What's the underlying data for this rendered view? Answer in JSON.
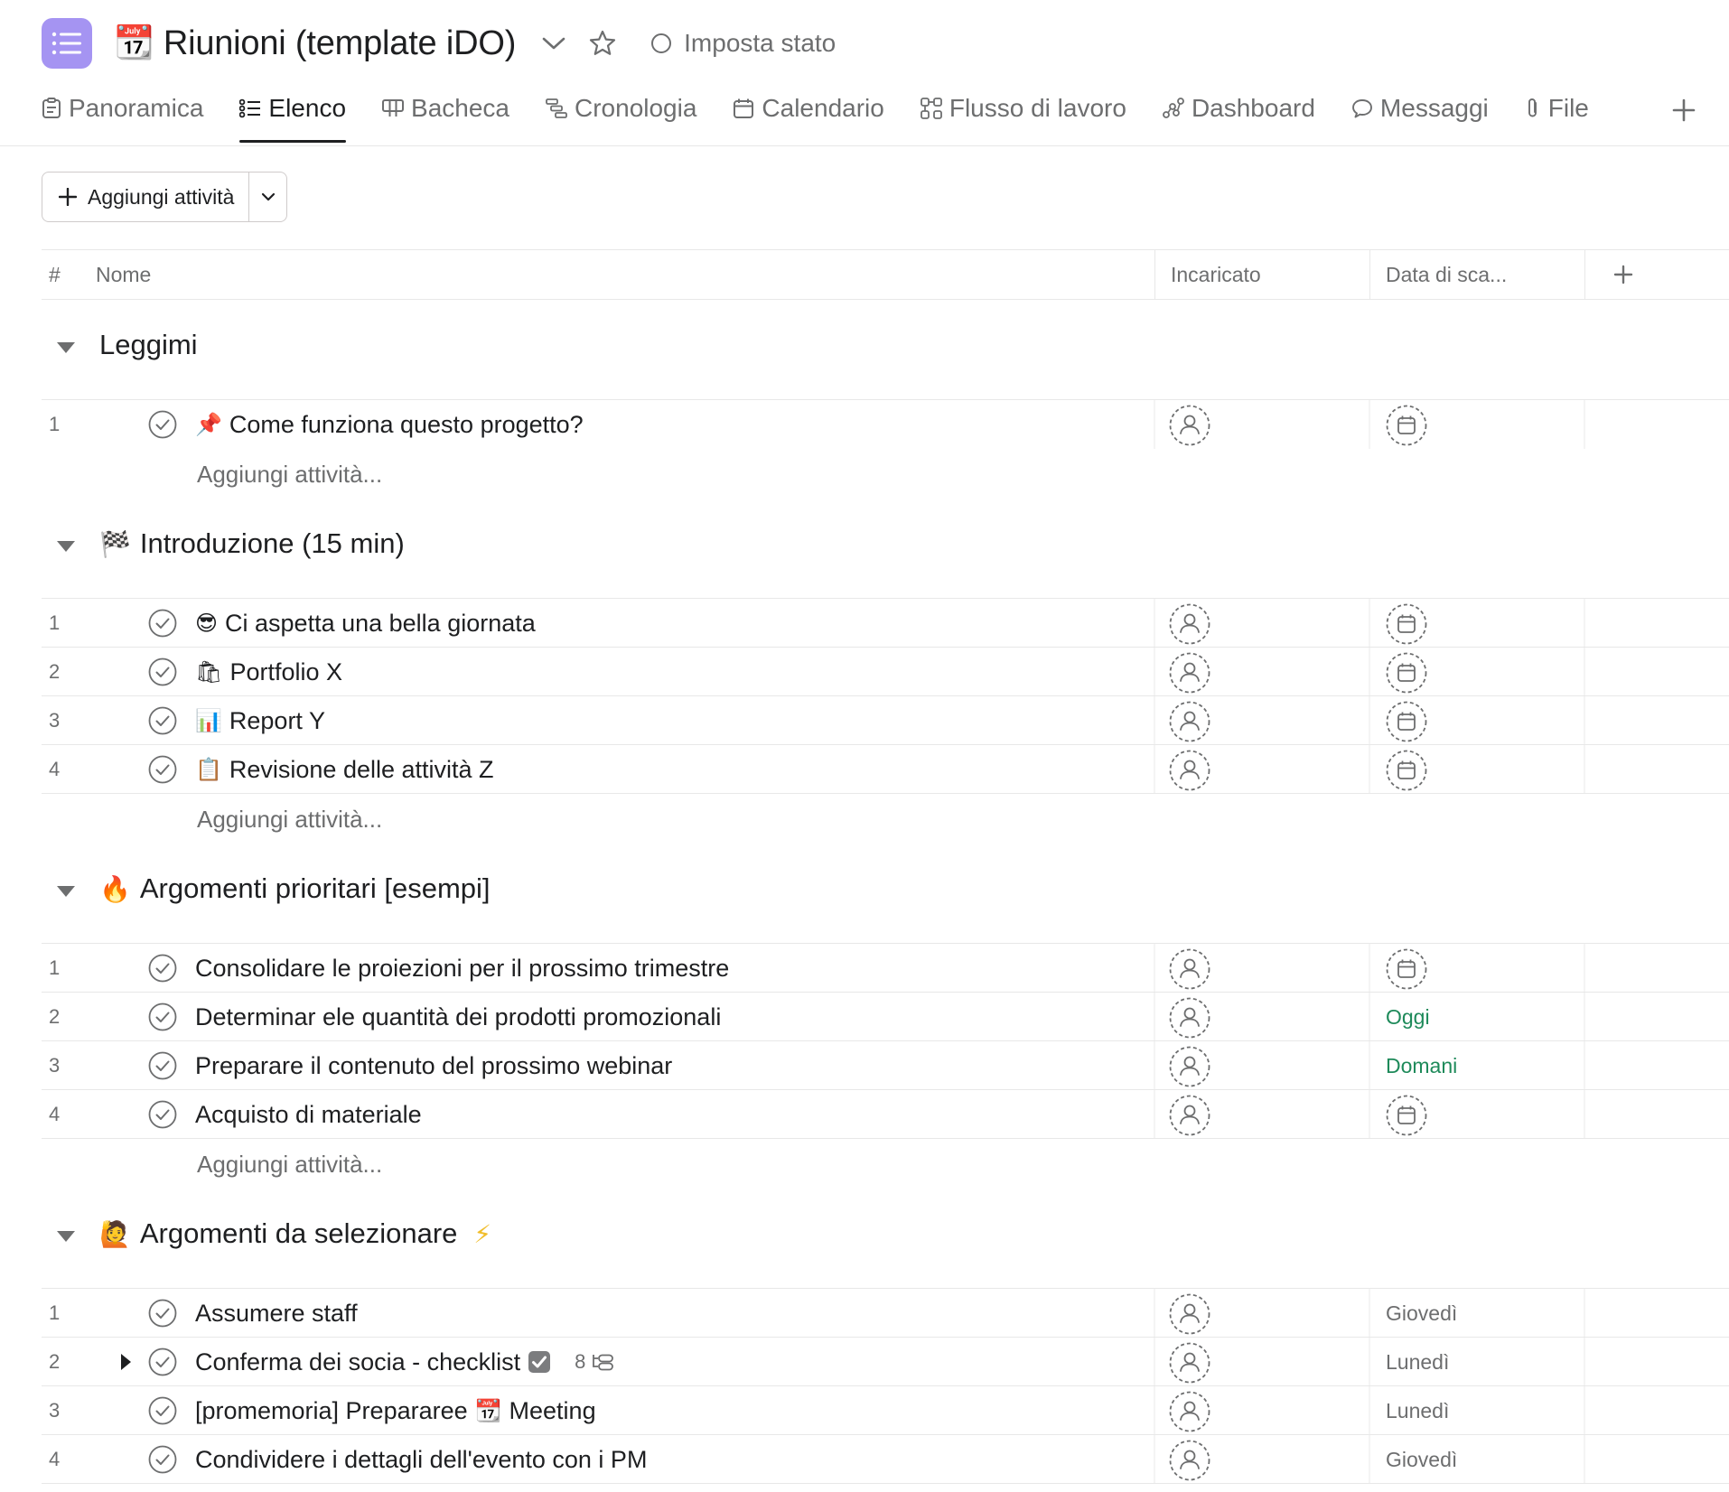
{
  "header": {
    "project_emoji": "📆",
    "project_title": "Riunioni (template iDO)",
    "status_label": "Imposta stato"
  },
  "tabs": [
    {
      "label": "Panoramica",
      "icon": "clipboard-icon",
      "active": false
    },
    {
      "label": "Elenco",
      "icon": "list-icon",
      "active": true
    },
    {
      "label": "Bacheca",
      "icon": "board-icon",
      "active": false
    },
    {
      "label": "Cronologia",
      "icon": "timeline-icon",
      "active": false
    },
    {
      "label": "Calendario",
      "icon": "calendar-icon",
      "active": false
    },
    {
      "label": "Flusso di lavoro",
      "icon": "workflow-icon",
      "active": false
    },
    {
      "label": "Dashboard",
      "icon": "dashboard-icon",
      "active": false
    },
    {
      "label": "Messaggi",
      "icon": "message-icon",
      "active": false
    },
    {
      "label": "File",
      "icon": "paperclip-icon",
      "active": false
    }
  ],
  "toolbar": {
    "add_task_label": "Aggiungi attività"
  },
  "table": {
    "col_num": "#",
    "col_name": "Nome",
    "col_assignee": "Incaricato",
    "col_due": "Data di sca..."
  },
  "add_task_placeholder": "Aggiungi attività...",
  "sections": [
    {
      "title": "Leggimi",
      "emoji": "",
      "tasks": [
        {
          "num": "1",
          "emoji": "📌",
          "name": "Come funziona questo progetto?",
          "due": ""
        }
      ]
    },
    {
      "title": "Introduzione (15 min)",
      "emoji": "🏁",
      "tasks": [
        {
          "num": "1",
          "emoji": "😎",
          "name": "Ci aspetta una bella giornata",
          "due": ""
        },
        {
          "num": "2",
          "emoji": "🛍",
          "name": "Portfolio X",
          "due": ""
        },
        {
          "num": "3",
          "emoji": "📊",
          "name": "Report Y",
          "due": ""
        },
        {
          "num": "4",
          "emoji": "📋",
          "name": "Revisione delle attività Z",
          "due": ""
        }
      ]
    },
    {
      "title": "Argomenti prioritari [esempi]",
      "emoji": "🔥",
      "tasks": [
        {
          "num": "1",
          "name": "Consolidare le proiezioni per il prossimo trimestre",
          "due": ""
        },
        {
          "num": "2",
          "name": "Determinar ele quantità dei prodotti promozionali",
          "due": "Oggi",
          "due_color": "#1e8a5a"
        },
        {
          "num": "3",
          "name": "Preparare il contenuto del prossimo webinar",
          "due": "Domani",
          "due_color": "#1e8a5a"
        },
        {
          "num": "4",
          "name": "Acquisto di materiale",
          "due": ""
        }
      ]
    },
    {
      "title": "Argomenti da selezionare",
      "emoji": "🙋",
      "emoji_after": "⚡",
      "tasks": [
        {
          "num": "1",
          "name": "Assumere staff",
          "due": "Giovedì"
        },
        {
          "num": "2",
          "name": "Conferma dei socia - checklist",
          "subtask_count": "8",
          "due": "Lunedì"
        },
        {
          "num": "3",
          "name_before": "[promemoria] Prepararee",
          "name_emoji": "📆",
          "name_after": "Meeting",
          "due": "Lunedì"
        },
        {
          "num": "4",
          "name": "Condividere i dettagli dell'evento con i PM",
          "due": "Giovedì"
        }
      ]
    }
  ]
}
